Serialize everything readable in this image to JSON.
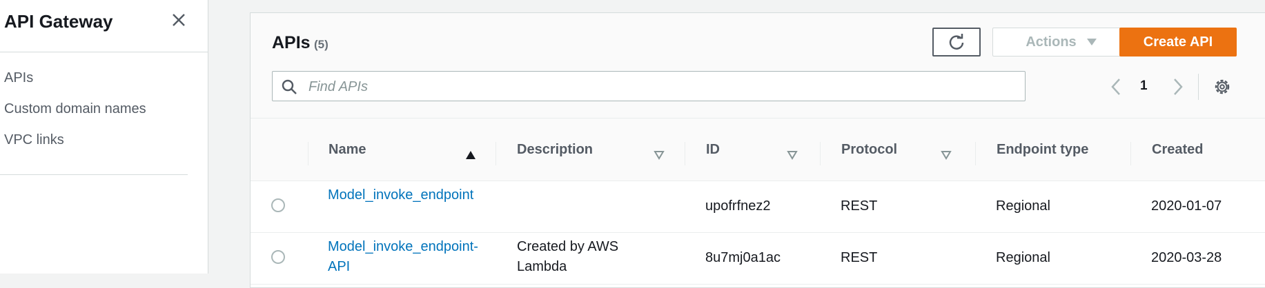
{
  "sidebar": {
    "title": "API Gateway",
    "items": [
      {
        "label": "APIs"
      },
      {
        "label": "Custom domain names"
      },
      {
        "label": "VPC links"
      }
    ]
  },
  "header": {
    "title": "APIs",
    "count": "(5)",
    "actions_label": "Actions",
    "create_label": "Create API"
  },
  "search": {
    "placeholder": "Find APIs",
    "value": ""
  },
  "pagination": {
    "current_page": "1"
  },
  "table": {
    "columns": [
      "Name",
      "Description",
      "ID",
      "Protocol",
      "Endpoint type",
      "Created"
    ],
    "rows": [
      {
        "name": "Model_invoke_endpoint",
        "description": "",
        "id": "upofrfnez2",
        "protocol": "REST",
        "endpoint_type": "Regional",
        "created": "2020-01-07"
      },
      {
        "name": "Model_invoke_endpoint-API",
        "description": "Created by AWS Lambda",
        "id": "8u7mj0a1ac",
        "protocol": "REST",
        "endpoint_type": "Regional",
        "created": "2020-03-28"
      }
    ]
  },
  "colors": {
    "accent": "#ec7211",
    "link": "#0073bb"
  }
}
